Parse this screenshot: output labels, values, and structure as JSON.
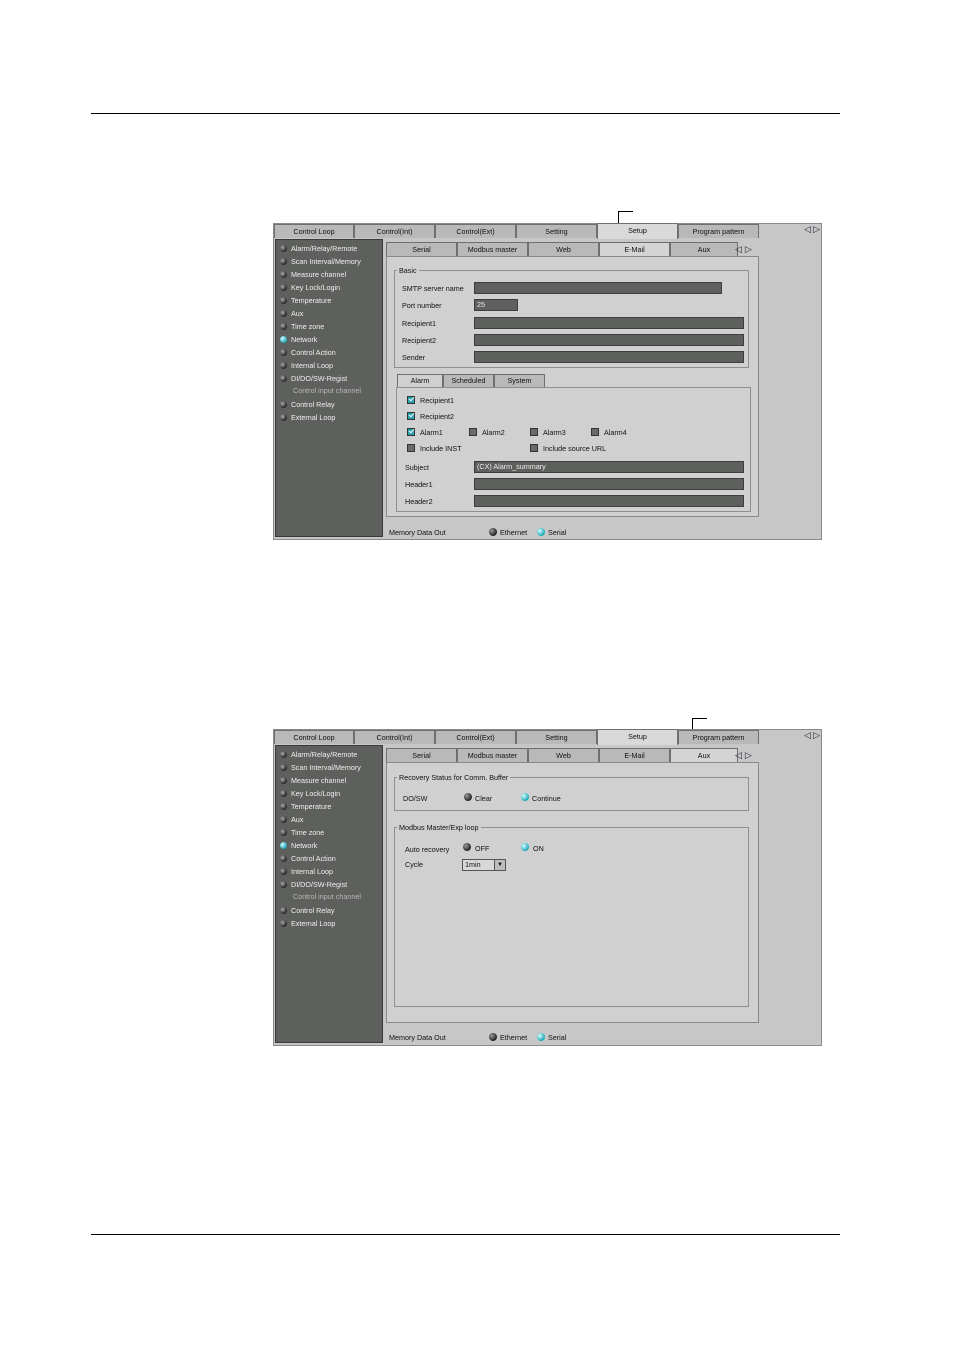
{
  "top_tabs": [
    "Control Loop",
    "Control(Int)",
    "Control(Ext)",
    "Setting",
    "Setup",
    "Program pattern"
  ],
  "sub_tabs": [
    "Serial",
    "Modbus master",
    "Web",
    "E-Mail",
    "Aux"
  ],
  "sidebar": {
    "items": [
      "Alarm/Relay/Remote",
      "Scan Interval/Memory",
      "Measure channel",
      "Key Lock/Login",
      "Temperature",
      "Aux",
      "Time zone",
      "Network",
      "Control Action",
      "Internal Loop",
      "DI/DO/SW-Regist",
      "Control Relay",
      "External Loop"
    ],
    "sub_item": "Control input channel"
  },
  "footer": {
    "label": "Memory Data Out",
    "ethernet": "Ethernet",
    "serial": "Serial"
  },
  "screen1": {
    "basic": {
      "legend": "Basic",
      "smtp_label": "SMTP server name",
      "smtp_value": "",
      "port_label": "Port number",
      "port_value": "25",
      "recipient1_label": "Recipient1",
      "recipient2_label": "Recipient2",
      "sender_label": "Sender"
    },
    "inner_tabs": [
      "Alarm",
      "Scheduled",
      "System"
    ],
    "alarm": {
      "recipient1": "Recipient1",
      "recipient2": "Recipient2",
      "alarm1": "Alarm1",
      "alarm2": "Alarm2",
      "alarm3": "Alarm3",
      "alarm4": "Alarm4",
      "include_inst": "Include INST",
      "include_url": "Include source URL",
      "subject_label": "Subject",
      "subject_value": "(CX) Alarm_summary",
      "header1_label": "Header1",
      "header2_label": "Header2"
    }
  },
  "screen2": {
    "recovery_legend": "Recovery Status for Comm. Buffer",
    "doswitch_label": "DO/SW",
    "clear": "Clear",
    "continue": "Continue",
    "modbus_legend": "Modbus Master/Exp loop",
    "auto_recovery_label": "Auto recovery",
    "off": "OFF",
    "on": "ON",
    "cycle_label": "Cycle",
    "cycle_value": "1min"
  }
}
